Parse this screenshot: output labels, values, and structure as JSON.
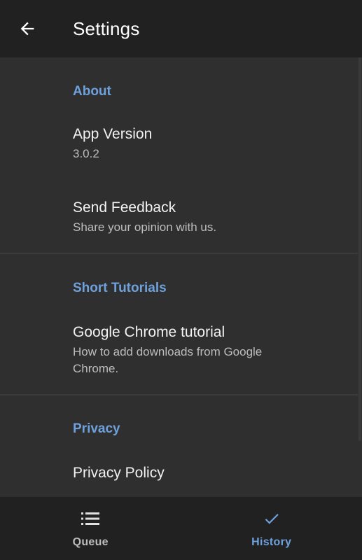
{
  "appbar": {
    "title": "Settings",
    "back_icon": "arrow-back-icon"
  },
  "sections": {
    "about": {
      "header": "About",
      "app_version": {
        "title": "App Version",
        "summary": "3.0.2"
      },
      "send_feedback": {
        "title": "Send Feedback",
        "summary": "Share your opinion with us."
      }
    },
    "tutorials": {
      "header": "Short Tutorials",
      "chrome_tutorial": {
        "title": "Google Chrome tutorial",
        "summary": "How to add downloads from Google Chrome."
      }
    },
    "privacy": {
      "header": "Privacy",
      "privacy_policy": {
        "title": "Privacy Policy"
      }
    }
  },
  "bottom_nav": {
    "queue": {
      "label": "Queue",
      "icon": "list-icon"
    },
    "history": {
      "label": "History",
      "icon": "check-icon",
      "active": true
    }
  },
  "colors": {
    "accent": "#6ea0dc",
    "appbar_bg": "#212121",
    "content_bg": "#2f2f2f"
  }
}
